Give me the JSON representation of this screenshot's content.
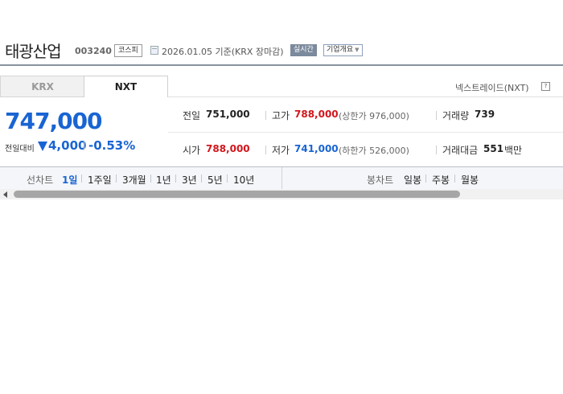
{
  "header": {
    "company_name": "태광산업",
    "stock_code": "003240",
    "market_badge": "코스피",
    "date_text": "2026.01.05 기준(KRX 장마감)",
    "realtime_label": "실시간",
    "company_overview_label": "기업개요"
  },
  "exchange_tabs": [
    {
      "label": "KRX",
      "active": false
    },
    {
      "label": "NXT",
      "active": true
    }
  ],
  "nextrade_label": "넥스트레이드(NXT)",
  "price": {
    "current": "747,000",
    "change_label": "전일대비",
    "change_value": "4,000",
    "change_rate": "-0.53%",
    "direction": "down"
  },
  "info": {
    "prev_close_label": "전일",
    "prev_close": "751,000",
    "high_label": "고가",
    "high": "788,000",
    "upper_limit": "(상한가 976,000)",
    "volume_label": "거래량",
    "volume": "739",
    "open_label": "시가",
    "open": "788,000",
    "low_label": "저가",
    "low": "741,000",
    "lower_limit": "(하한가 526,000)",
    "trade_value_label": "거래대금",
    "trade_value": "551",
    "trade_value_unit": "백만"
  },
  "chart_bar": {
    "line_chart_label": "선차트",
    "line_periods": [
      "1일",
      "1주일",
      "3개월",
      "1년",
      "3년",
      "5년",
      "10년"
    ],
    "active_period": "1일",
    "candle_chart_label": "봉차트",
    "candle_periods": [
      "일봉",
      "주봉",
      "월봉"
    ]
  },
  "colors": {
    "up": "#d2161c",
    "down": "#1964d3",
    "title_rule": "#8a929c"
  },
  "icons": {
    "help": "question-icon",
    "direction": "triangle-down-icon",
    "date": "document-icon"
  }
}
